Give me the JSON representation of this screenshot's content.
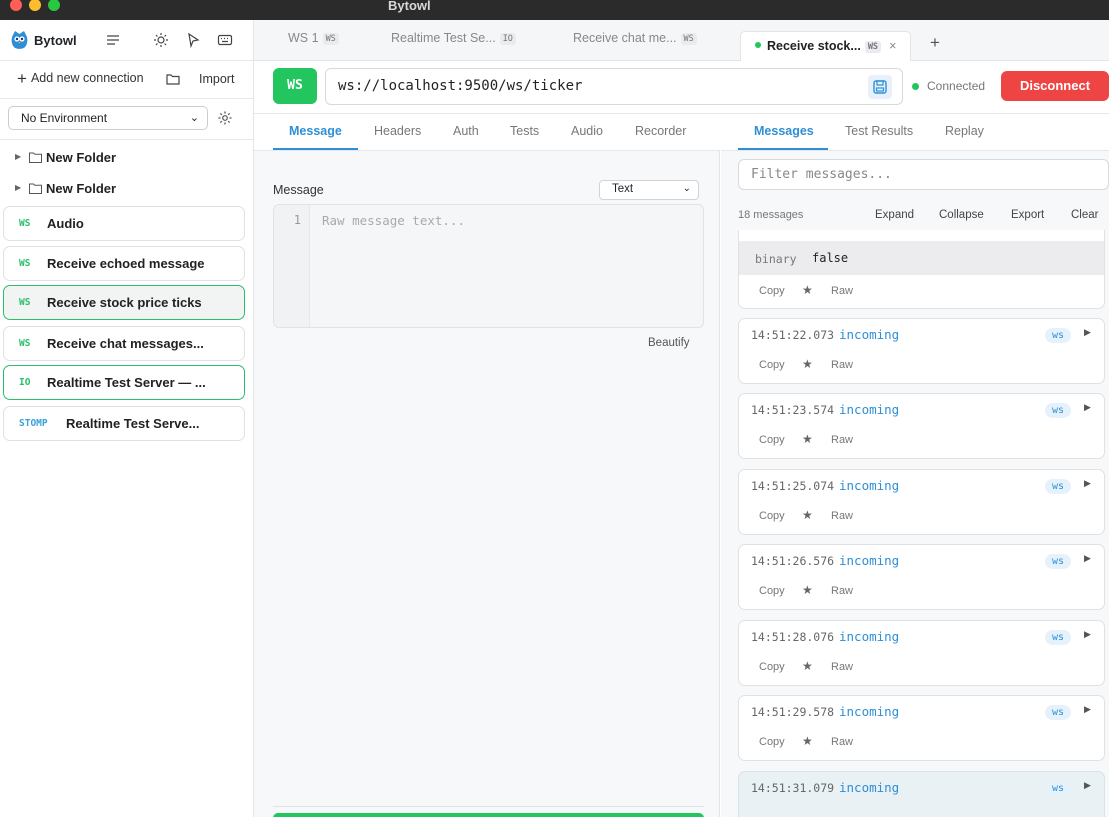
{
  "window": {
    "title": "Bytowl"
  },
  "sidebar": {
    "brand": "Bytowl",
    "add_connection": "Add new connection",
    "import": "Import",
    "environment": "No Environment",
    "folders": [
      "New Folder",
      "New Folder"
    ],
    "connections": [
      {
        "badge": "WS",
        "name": "Audio"
      },
      {
        "badge": "WS",
        "name": "Receive echoed message"
      },
      {
        "badge": "WS",
        "name": "Receive stock price ticks"
      },
      {
        "badge": "WS",
        "name": "Receive chat messages..."
      },
      {
        "badge": "IO",
        "name": "Realtime Test Server — ..."
      },
      {
        "badge": "STOMP",
        "name": "Realtime Test Serve..."
      }
    ]
  },
  "tabs": [
    {
      "label": "WS 1",
      "badge": "WS"
    },
    {
      "label": "Realtime Test Se...",
      "badge": "IO"
    },
    {
      "label": "Receive chat me...",
      "badge": "WS"
    },
    {
      "label": "Receive stock...",
      "badge": "WS"
    }
  ],
  "urlbar": {
    "protocol": "WS",
    "url": "ws://localhost:9500/ws/ticker",
    "status": "Connected",
    "disconnect": "Disconnect"
  },
  "request": {
    "tabs": [
      "Message",
      "Headers",
      "Auth",
      "Tests",
      "Audio",
      "Recorder"
    ],
    "message_label": "Message",
    "type": "Text",
    "line_number": "1",
    "placeholder": "Raw message text...",
    "beautify": "Beautify"
  },
  "response": {
    "tabs": [
      "Messages",
      "Test Results",
      "Replay"
    ],
    "filter_placeholder": "Filter messages...",
    "count": "18 messages",
    "actions": [
      "Expand",
      "Collapse",
      "Export",
      "Clear"
    ],
    "first_card": {
      "key": "binary",
      "value": "false"
    },
    "copy": "Copy",
    "raw": "Raw",
    "star": "★",
    "messages": [
      {
        "time": "14:51:22.073",
        "direction": "incoming",
        "badge": "ws"
      },
      {
        "time": "14:51:23.574",
        "direction": "incoming",
        "badge": "ws"
      },
      {
        "time": "14:51:25.074",
        "direction": "incoming",
        "badge": "ws"
      },
      {
        "time": "14:51:26.576",
        "direction": "incoming",
        "badge": "ws"
      },
      {
        "time": "14:51:28.076",
        "direction": "incoming",
        "badge": "ws"
      },
      {
        "time": "14:51:29.578",
        "direction": "incoming",
        "badge": "ws"
      },
      {
        "time": "14:51:31.079",
        "direction": "incoming",
        "badge": "ws"
      }
    ]
  },
  "colors": {
    "accent_green": "#22c55e",
    "accent_blue": "#2e8fd6",
    "danger": "#ef4444"
  }
}
